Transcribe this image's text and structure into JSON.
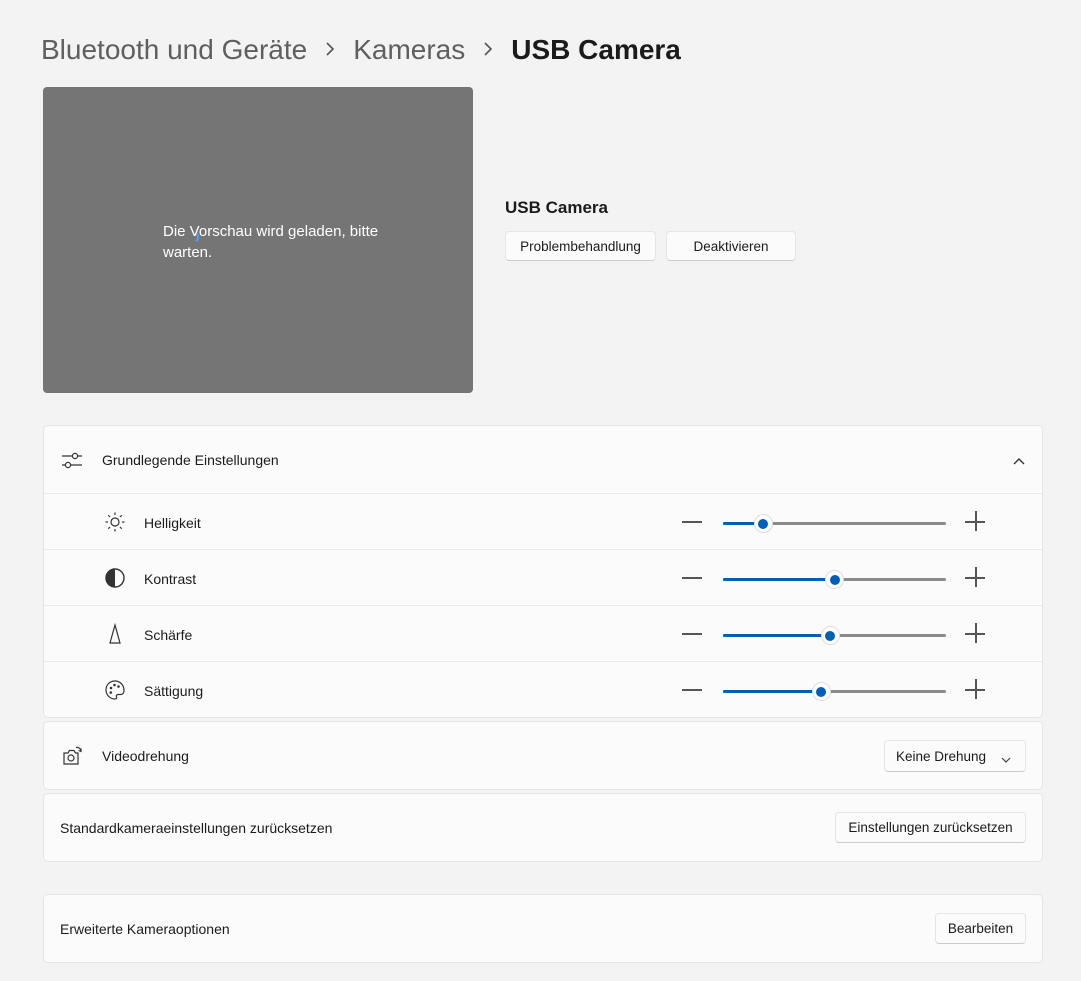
{
  "breadcrumb": {
    "items": [
      "Bluetooth und Geräte",
      "Kameras",
      "USB Camera"
    ]
  },
  "preview": {
    "loading_text": "Die Vorschau wird geladen, bitte warten."
  },
  "device": {
    "name": "USB Camera",
    "troubleshoot_label": "Problembehandlung",
    "disable_label": "Deaktivieren"
  },
  "basic_settings": {
    "title": "Grundlegende Einstellungen",
    "expanded": true,
    "sliders": [
      {
        "label": "Helligkeit",
        "icon": "brightness-icon",
        "value_fraction": 0.18
      },
      {
        "label": "Kontrast",
        "icon": "contrast-icon",
        "value_fraction": 0.5
      },
      {
        "label": "Schärfe",
        "icon": "sharpness-icon",
        "value_fraction": 0.48
      },
      {
        "label": "Sättigung",
        "icon": "palette-icon",
        "value_fraction": 0.44
      }
    ]
  },
  "rotation": {
    "label": "Videodrehung",
    "selected": "Keine Drehung"
  },
  "reset": {
    "label": "Standardkameraeinstellungen zurücksetzen",
    "button_label": "Einstellungen zurücksetzen"
  },
  "advanced": {
    "label": "Erweiterte Kameraoptionen",
    "button_label": "Bearbeiten"
  },
  "colors": {
    "accent": "#005fb8",
    "background": "#f3f3f3",
    "card": "#fbfbfb",
    "preview": "#757575"
  }
}
